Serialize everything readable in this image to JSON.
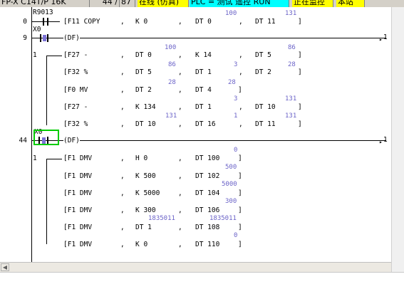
{
  "statusbar": {
    "model": "FP-X C14T/P 16K",
    "step": "44 /",
    "total": "87",
    "mode": "在线 (仿真)",
    "plc_status": "PLC = 测试 遥控 RUN",
    "monitor": "正在监控",
    "station": "本站"
  },
  "rungs": [
    {
      "no": "0",
      "contact": "R9013",
      "instr": "[F11 COPY",
      "op1": "K 0",
      "op2": "DT 0",
      "op3": "DT 11",
      "close": "]",
      "mon1": "",
      "mon2": "100",
      "mon3": "131"
    },
    {
      "no": "9",
      "contact": "X0",
      "instr": "(DF)"
    },
    {
      "no": "",
      "branch": "1",
      "instr": "[F27 -",
      "op1": "DT 0",
      "op2": "K 14",
      "op3": "DT 5",
      "close": "]",
      "mon1": "100",
      "mon2": "",
      "mon3": "86"
    },
    {
      "no": "",
      "instr": "[F32 %",
      "op1": "DT 5",
      "op2": "DT 1",
      "op3": "DT 2",
      "close": "]",
      "mon1": "86",
      "mon2": "3",
      "mon3": "28"
    },
    {
      "no": "",
      "instr": "[F0 MV",
      "op1": "DT 2",
      "op2": "DT 4",
      "close": "]",
      "mon1": "28",
      "mon2": "28"
    },
    {
      "no": "",
      "instr": "[F27 -",
      "op1": "K 134",
      "op2": "DT 1",
      "op3": "DT 10",
      "close": "]",
      "mon1": "",
      "mon2": "3",
      "mon3": "131"
    },
    {
      "no": "",
      "instr": "[F32 %",
      "op1": "DT 10",
      "op2": "DT 16",
      "op3": "DT 11",
      "close": "]",
      "mon1": "131",
      "mon2": "1",
      "mon3": "131"
    },
    {
      "no": "44",
      "contact": "X0",
      "instr": "(DF)"
    },
    {
      "no": "",
      "branch": "1",
      "instr": "[F1 DMV",
      "op1": "H 0",
      "op2": "DT 100",
      "close": "]",
      "mon1": "",
      "mon2": "0"
    },
    {
      "no": "",
      "instr": "[F1 DMV",
      "op1": "K 500",
      "op2": "DT 102",
      "close": "]",
      "mon1": "",
      "mon2": "500"
    },
    {
      "no": "",
      "instr": "[F1 DMV",
      "op1": "K 5000",
      "op2": "DT 104",
      "close": "]",
      "mon1": "",
      "mon2": "5000"
    },
    {
      "no": "",
      "instr": "[F1 DMV",
      "op1": "K 300",
      "op2": "DT 106",
      "close": "]",
      "mon1": "",
      "mon2": "300"
    },
    {
      "no": "",
      "instr": "[F1 DMV",
      "op1": "DT 1",
      "op2": "DT 108",
      "close": "]",
      "mon1": "1835011",
      "mon2": "1835011"
    },
    {
      "no": "",
      "instr": "[F1 DMV",
      "op1": "K 0",
      "op2": "DT 110",
      "close": "]",
      "mon1": "",
      "mon2": "0"
    }
  ],
  "labels": {
    "comma": ",",
    "end_mark_1": "1",
    "scroll_left": "◀"
  }
}
